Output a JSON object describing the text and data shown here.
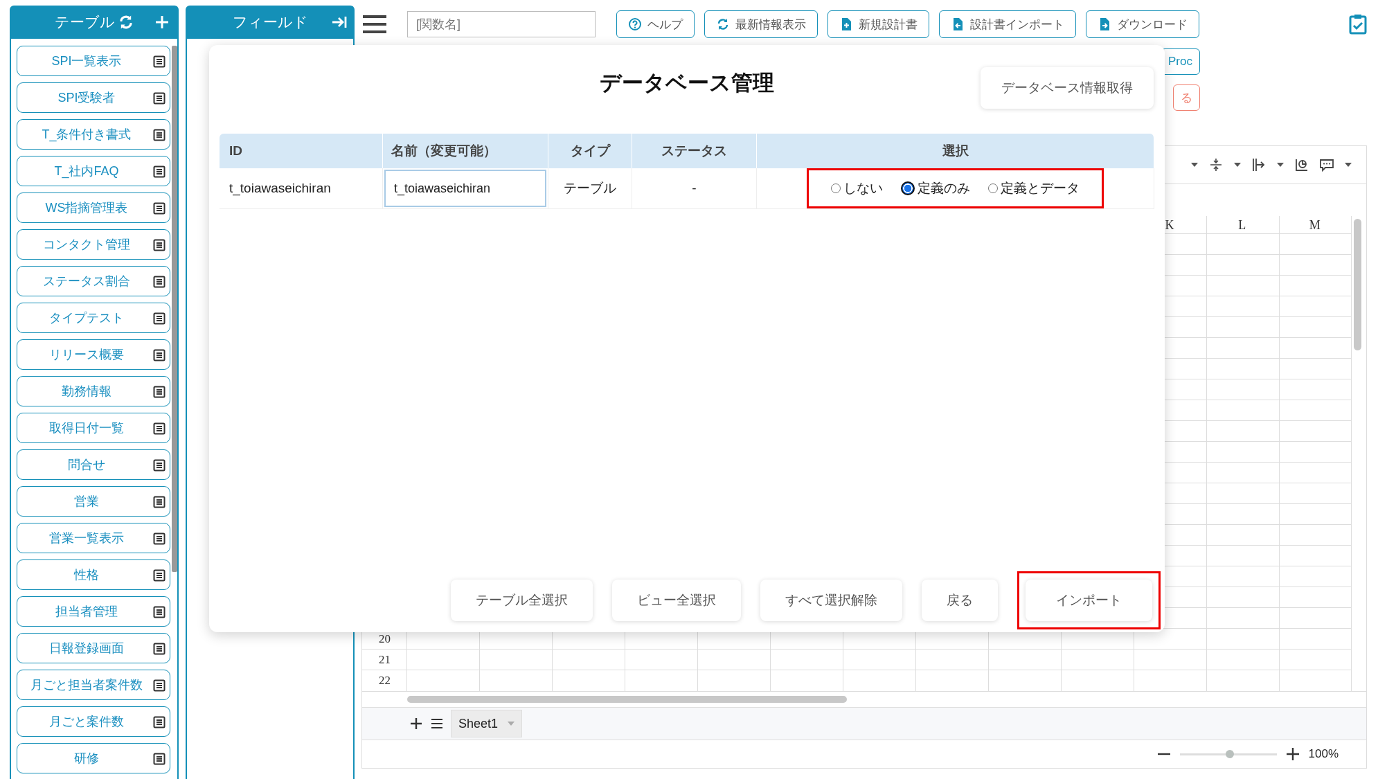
{
  "sidebar": {
    "title": "テーブル",
    "items": [
      {
        "label": "SPI一覧表示"
      },
      {
        "label": "SPI受験者"
      },
      {
        "label": "T_条件付き書式"
      },
      {
        "label": "T_社内FAQ"
      },
      {
        "label": "WS指摘管理表"
      },
      {
        "label": "コンタクト管理"
      },
      {
        "label": "ステータス割合"
      },
      {
        "label": "タイプテスト"
      },
      {
        "label": "リリース概要"
      },
      {
        "label": "勤務情報"
      },
      {
        "label": "取得日付一覧"
      },
      {
        "label": "問合せ"
      },
      {
        "label": "営業"
      },
      {
        "label": "営業一覧表示"
      },
      {
        "label": "性格"
      },
      {
        "label": "担当者管理"
      },
      {
        "label": "日報登録画面"
      },
      {
        "label": "月ごと担当者案件数"
      },
      {
        "label": "月ごと案件数"
      },
      {
        "label": "研修"
      }
    ]
  },
  "field_panel": {
    "title": "フィールド"
  },
  "search": {
    "placeholder": "[関数名]"
  },
  "toolbar": {
    "buttons": [
      {
        "label": "ヘルプ",
        "kind": "help"
      },
      {
        "label": "最新情報表示",
        "kind": "refresh"
      },
      {
        "label": "新規設計書",
        "kind": "new"
      },
      {
        "label": "設計書インポート",
        "kind": "import"
      },
      {
        "label": "ダウンロード",
        "kind": "download"
      }
    ]
  },
  "side_buttons": [
    {
      "label": "Proc",
      "kind": "normal"
    },
    {
      "label": "る",
      "kind": "danger"
    }
  ],
  "spreadsheet": {
    "columns": [
      "K",
      "L",
      "M"
    ],
    "rows": [
      "20",
      "21",
      "22"
    ],
    "sheet_tab": "Sheet1",
    "zoom": {
      "level": 0.52,
      "reading": "100%"
    }
  },
  "dialog": {
    "title": "データベース管理",
    "fetch_button": "データベース情報取得",
    "columns": [
      "ID",
      "名前（変更可能）",
      "タイプ",
      "ステータス",
      "選択"
    ],
    "rows": [
      {
        "id": "t_toiawaseichiran",
        "name": "t_toiawaseichiran",
        "type": "テーブル",
        "status": "-",
        "highlighted": true,
        "options": [
          {
            "label": "しない",
            "selected": false
          },
          {
            "label": "定義のみ",
            "selected": true
          },
          {
            "label": "定義とデータ",
            "selected": false
          }
        ]
      }
    ],
    "buttons": [
      {
        "label": "テーブル全選択",
        "highlighted": false
      },
      {
        "label": "ビュー全選択",
        "highlighted": false
      },
      {
        "label": "すべて選択解除",
        "highlighted": false
      },
      {
        "label": "戻る",
        "highlighted": false
      },
      {
        "label": "インポート",
        "highlighted": true
      }
    ]
  }
}
